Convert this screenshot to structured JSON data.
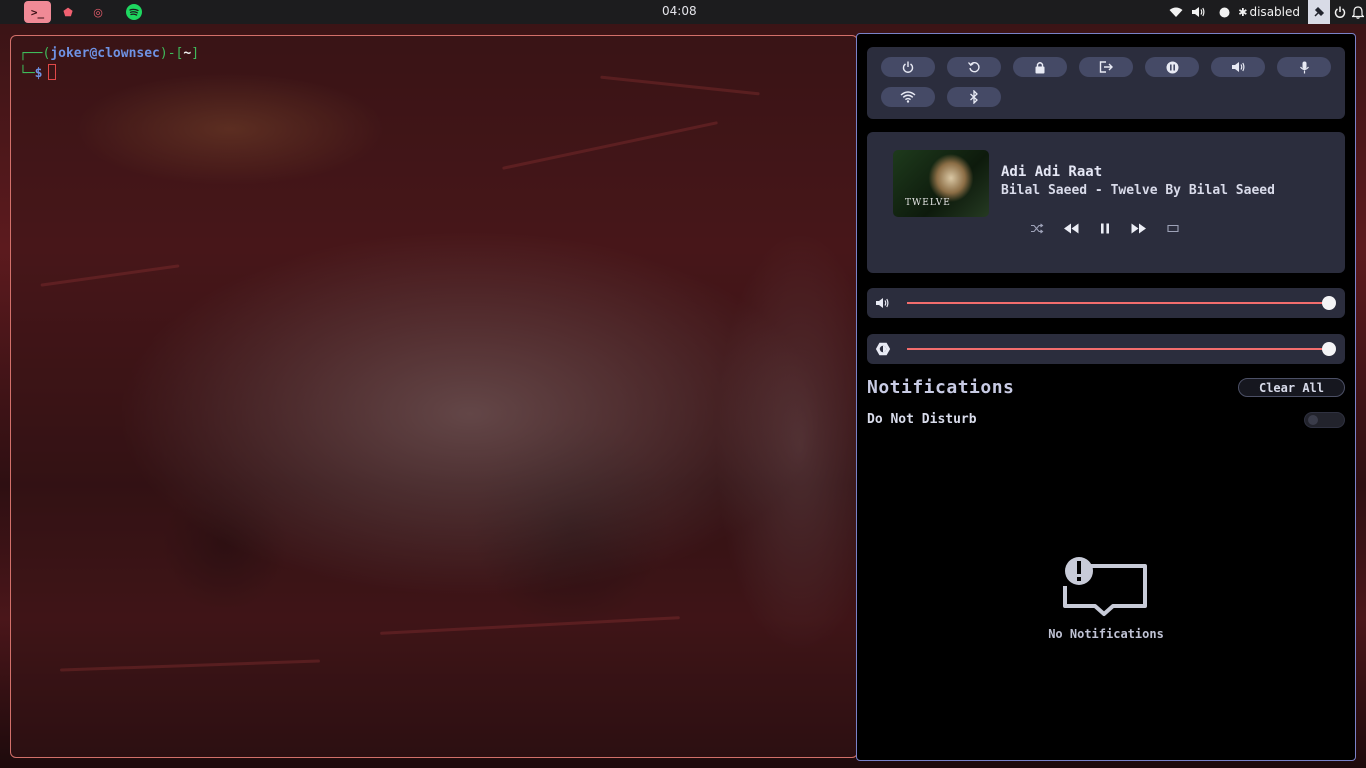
{
  "topbar": {
    "apps": [
      {
        "name": "terminal",
        "glyph": ">_"
      },
      {
        "name": "vivaldi",
        "glyph": "⬟"
      },
      {
        "name": "app-red",
        "glyph": "◎"
      },
      {
        "name": "spotify",
        "glyph": "◉"
      }
    ],
    "clock": "04:08",
    "status": {
      "wifi": "wifi-icon",
      "volume": "volume-icon",
      "record": "record-icon",
      "bluetooth_label": "disabled"
    }
  },
  "terminal": {
    "prompt_open": "┌──(",
    "user_host": "joker@clownsec",
    "prompt_mid": ")-[",
    "path": "~",
    "prompt_close": "]",
    "prompt_line2": "└─",
    "dollar": "$"
  },
  "quick_settings": {
    "buttons": [
      {
        "id": "power",
        "icon": "power-icon"
      },
      {
        "id": "reboot",
        "icon": "reboot-icon"
      },
      {
        "id": "lock",
        "icon": "lock-icon"
      },
      {
        "id": "logout",
        "icon": "logout-icon"
      },
      {
        "id": "suspend",
        "icon": "pause-circle-icon"
      },
      {
        "id": "audio",
        "icon": "volume-icon"
      },
      {
        "id": "mic",
        "icon": "microphone-icon"
      },
      {
        "id": "wifi",
        "icon": "wifi-icon"
      },
      {
        "id": "bluetooth",
        "icon": "bluetooth-icon"
      }
    ]
  },
  "media": {
    "title": "Adi Adi Raat",
    "artist_album": "Bilal Saeed - Twelve By Bilal Saeed",
    "cover_text": "TWELVE",
    "controls": [
      "shuffle-icon",
      "previous-icon",
      "pause-icon",
      "next-icon",
      "repeat-icon"
    ]
  },
  "sliders": {
    "volume": {
      "icon": "volume-icon",
      "level": 1.0
    },
    "brightness": {
      "icon": "brightness-icon",
      "level": 1.0
    }
  },
  "notifications": {
    "title": "Notifications",
    "clear_all": "Clear All",
    "dnd_label": "Do Not Disturb",
    "dnd_enabled": false,
    "empty_text": "No Notifications"
  },
  "colors": {
    "accent": "#f36d6d",
    "panel_card": "#2b2d3d",
    "panel_border": "#7a82c8",
    "terminal_border": "#d2706a"
  }
}
